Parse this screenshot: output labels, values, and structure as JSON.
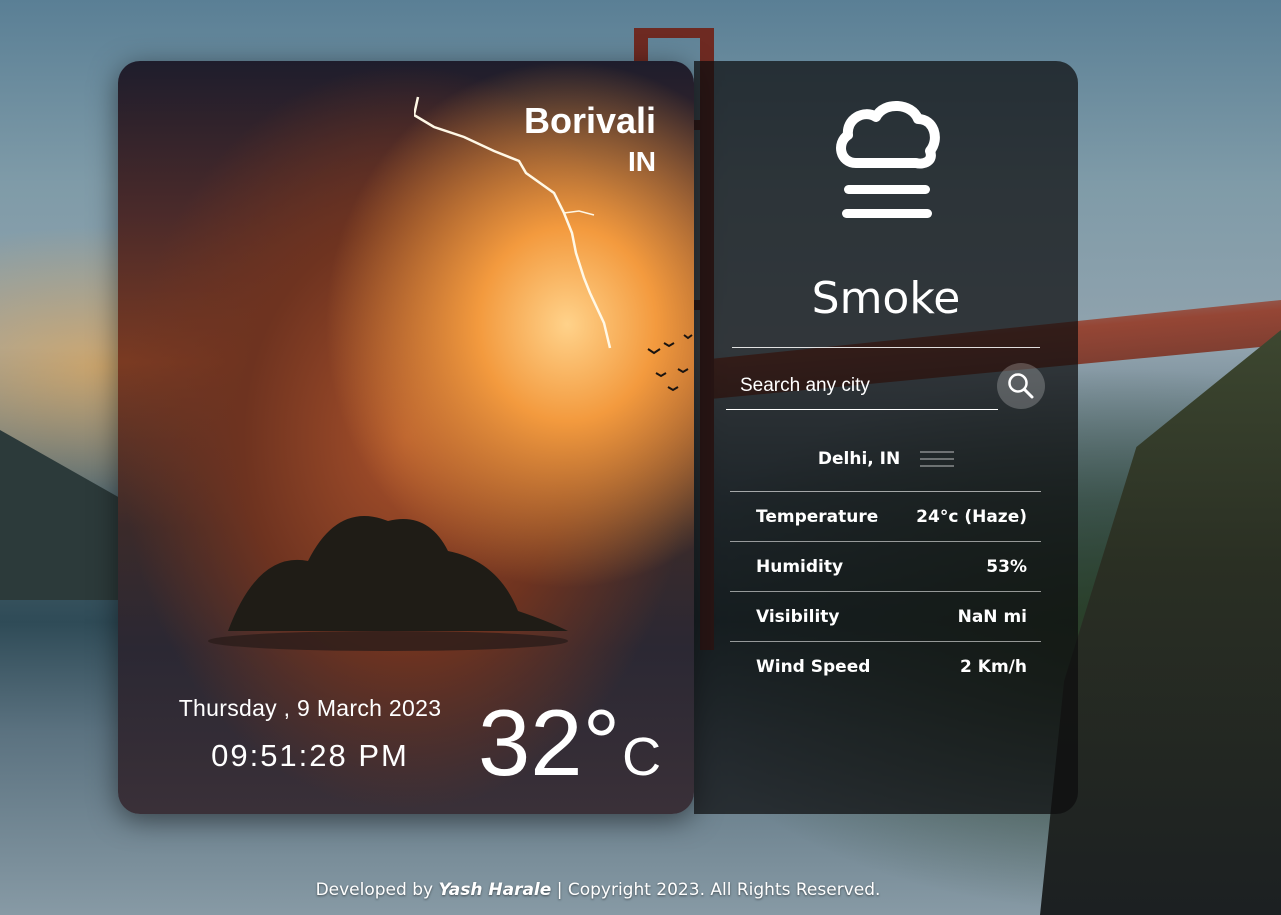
{
  "location": {
    "city": "Borivali",
    "country": "IN"
  },
  "datetime": {
    "date": "Thursday , 9 March 2023",
    "time": "09:51:28 PM"
  },
  "temperature": {
    "value": "32",
    "degree": "°",
    "unit": "C"
  },
  "condition": {
    "main": "Smoke",
    "icon": "smoke-icon"
  },
  "search": {
    "placeholder": "Search any city",
    "value": ""
  },
  "details": {
    "location": "Delhi, IN",
    "rows": [
      {
        "label": "Temperature",
        "value": "24°c (Haze)"
      },
      {
        "label": "Humidity",
        "value": "53%"
      },
      {
        "label": "Visibility",
        "value": "NaN mi"
      },
      {
        "label": "Wind Speed",
        "value": "2 Km/h"
      }
    ]
  },
  "footer": {
    "prefix": "Developed by",
    "author": "Yash Harale",
    "suffix": "| Copyright 2023. All Rights Reserved."
  }
}
